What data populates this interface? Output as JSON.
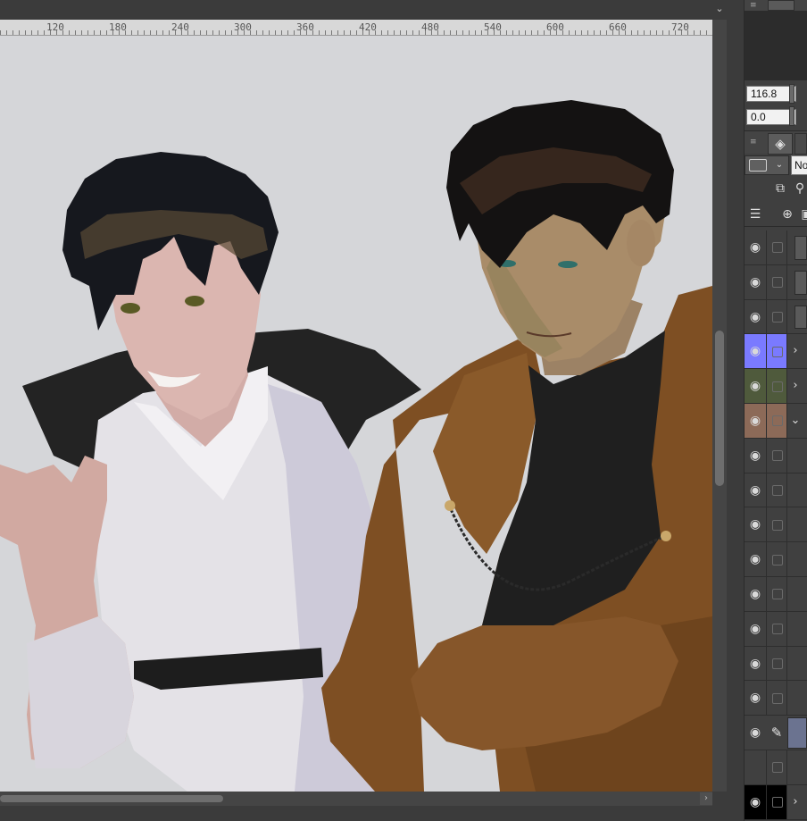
{
  "ruler": {
    "labels": [
      "120",
      "180",
      "240",
      "300",
      "360",
      "420",
      "480",
      "540",
      "600",
      "660",
      "720"
    ]
  },
  "canvas": {
    "background": "#d5d6d9",
    "palette": {
      "jacket_brown": "#7e4f23",
      "turtleneck": "#1f1f1f",
      "shirt": "#e6e3e8",
      "skin_left": "#d6b3ad",
      "skin_right": "#a58a67",
      "hair": "#141414",
      "collar_black": "#222222"
    }
  },
  "navigator": {
    "zoom_value": "116.8",
    "rotation_value": "0.0"
  },
  "layer_panel": {
    "blend_mode_visible": "No",
    "color_colors": {
      "swatch": "#606060"
    },
    "layers": [
      {
        "visible": true,
        "folder": false,
        "color": ""
      },
      {
        "visible": true,
        "folder": false,
        "color": ""
      },
      {
        "visible": true,
        "folder": false,
        "color": ""
      },
      {
        "visible": true,
        "folder": true,
        "expanded": false,
        "color": "#7a7aff"
      },
      {
        "visible": true,
        "folder": true,
        "expanded": false,
        "color": "#4f5a3c"
      },
      {
        "visible": true,
        "folder": true,
        "expanded": true,
        "color": "#8c6a58"
      },
      {
        "visible": true,
        "folder": false,
        "color": ""
      },
      {
        "visible": true,
        "folder": false,
        "color": ""
      },
      {
        "visible": true,
        "folder": false,
        "color": ""
      },
      {
        "visible": true,
        "folder": false,
        "color": ""
      },
      {
        "visible": true,
        "folder": false,
        "color": ""
      },
      {
        "visible": true,
        "folder": false,
        "color": ""
      },
      {
        "visible": true,
        "folder": false,
        "color": ""
      },
      {
        "visible": true,
        "folder": false,
        "color": ""
      },
      {
        "visible": true,
        "folder": false,
        "editing": true,
        "color": ""
      },
      {
        "visible": false,
        "folder": false,
        "color": ""
      },
      {
        "visible": true,
        "folder": true,
        "expanded": false,
        "color": "#000000"
      }
    ]
  }
}
